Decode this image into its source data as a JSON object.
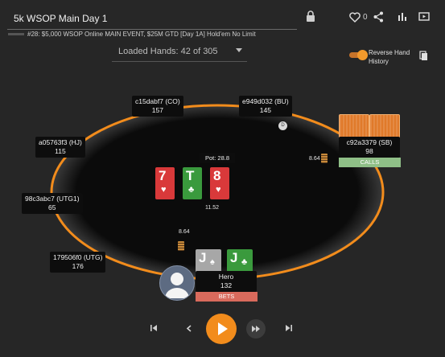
{
  "header": {
    "title": "5k WSOP Main Day 1",
    "subtitle": "#28: $5,000 WSOP Online MAIN EVENT, $25M GTD [Day 1A] Hold'em No Limit",
    "likes": "0"
  },
  "hands": {
    "loaded_label": "Loaded Hands: 42 of 305"
  },
  "reverse": {
    "label": "Reverse Hand History",
    "enabled": true
  },
  "pot": {
    "label": "Pot: 28.8",
    "center_bet": "11.52"
  },
  "board": [
    {
      "rank": "7",
      "suit": "♥",
      "color": "red"
    },
    {
      "rank": "T",
      "suit": "♣",
      "color": "green"
    },
    {
      "rank": "8",
      "suit": "♥",
      "color": "red"
    }
  ],
  "seats": [
    {
      "name": "c15dabf7 (CO)",
      "stack": "157"
    },
    {
      "name": "e949d032 (BU)",
      "stack": "145"
    },
    {
      "name": "c92a3379 (SB)",
      "stack": "98",
      "action": "CALLS",
      "bet": "8.64"
    },
    {
      "name": "a05763f3 (HJ)",
      "stack": "115"
    },
    {
      "name": "98c3abc7 (UTG1)",
      "stack": "65"
    },
    {
      "name": "179506f0 (UTG)",
      "stack": "176"
    },
    {
      "name": "Hero",
      "stack": "132",
      "action": "BETS",
      "bet": "8.64"
    }
  ],
  "hero_cards": [
    {
      "rank": "J",
      "suit": "♠",
      "color": "gray"
    },
    {
      "rank": "J",
      "suit": "♣",
      "color": "green"
    }
  ],
  "dealer_button": "D",
  "colors": {
    "accent": "#f28c1c",
    "calls": "#8fbf87",
    "bets": "#d96a5c",
    "table": "#0a0a0a"
  }
}
